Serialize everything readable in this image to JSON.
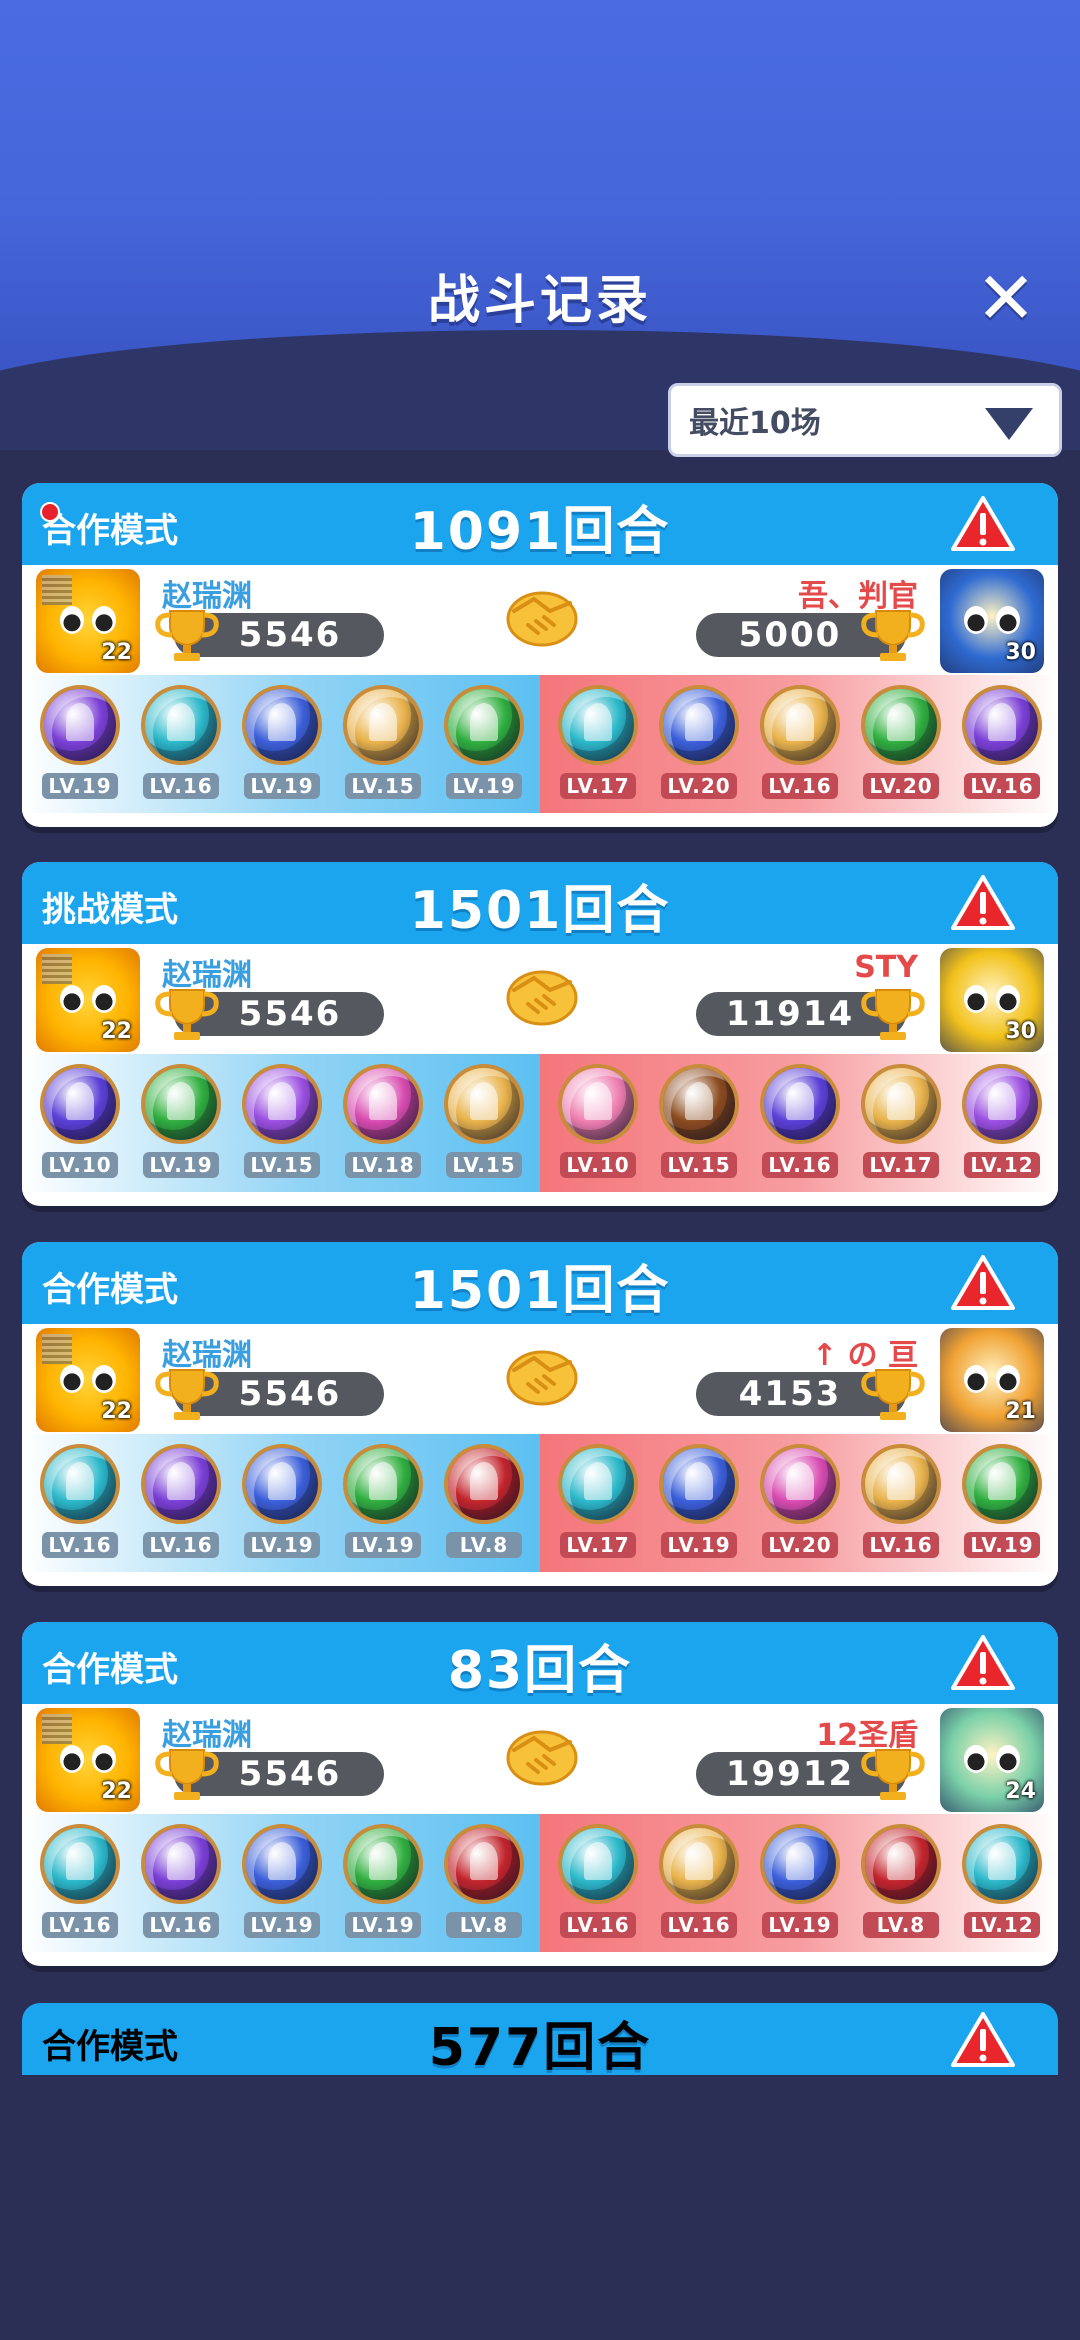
{
  "header": {
    "title": "战斗记录",
    "close_label": "✕"
  },
  "filter": {
    "label": "最近10场"
  },
  "orb_colors": {
    "purple": "#7a3fd6",
    "teal": "#2bb8c9",
    "blue": "#3b5fd9",
    "gold": "#e8b24a",
    "green": "#2fae3e",
    "pink": "#d84bb0",
    "red": "#c2242b",
    "brown": "#8b4a1e",
    "rose": "#ee7fb0"
  },
  "cards": [
    {
      "mode": "合作模式",
      "rounds": "1091回合",
      "left": {
        "name": "赵瑞渊",
        "score": "5546",
        "avatar_level": "22"
      },
      "right": {
        "name": "吾、判官",
        "score": "5000",
        "avatar_level": "30",
        "avatar_color": "#2f6bd1"
      },
      "left_pets": [
        {
          "level": "LV.19",
          "color": "#7a3fd6"
        },
        {
          "level": "LV.16",
          "color": "#2bb8c9"
        },
        {
          "level": "LV.19",
          "color": "#3b5fd9"
        },
        {
          "level": "LV.15",
          "color": "#e8b24a"
        },
        {
          "level": "LV.19",
          "color": "#2fae3e"
        }
      ],
      "right_pets": [
        {
          "level": "LV.17",
          "color": "#2bb8c9"
        },
        {
          "level": "LV.20",
          "color": "#3b5fd9"
        },
        {
          "level": "LV.16",
          "color": "#e8b24a"
        },
        {
          "level": "LV.20",
          "color": "#2fae3e"
        },
        {
          "level": "LV.16",
          "color": "#7a3fd6"
        }
      ]
    },
    {
      "mode": "挑战模式",
      "rounds": "1501回合",
      "left": {
        "name": "赵瑞渊",
        "score": "5546",
        "avatar_level": "22"
      },
      "right": {
        "name": "STY",
        "score": "11914",
        "avatar_level": "30",
        "avatar_color": "#f2c21b"
      },
      "left_pets": [
        {
          "level": "LV.10",
          "color": "#5b3fd6"
        },
        {
          "level": "LV.19",
          "color": "#2fae3e"
        },
        {
          "level": "LV.15",
          "color": "#9a4fe0"
        },
        {
          "level": "LV.18",
          "color": "#d84bb0"
        },
        {
          "level": "LV.15",
          "color": "#e8b24a"
        }
      ],
      "right_pets": [
        {
          "level": "LV.10",
          "color": "#ee7fb0"
        },
        {
          "level": "LV.15",
          "color": "#8b4a1e"
        },
        {
          "level": "LV.16",
          "color": "#5b3fd6"
        },
        {
          "level": "LV.17",
          "color": "#e8b24a"
        },
        {
          "level": "LV.12",
          "color": "#9a4fe0"
        }
      ]
    },
    {
      "mode": "合作模式",
      "rounds": "1501回合",
      "left": {
        "name": "赵瑞渊",
        "score": "5546",
        "avatar_level": "22"
      },
      "right": {
        "name": "↑ の 亘",
        "score": "4153",
        "avatar_level": "21",
        "avatar_color": "#f0a233"
      },
      "left_pets": [
        {
          "level": "LV.16",
          "color": "#2bb8c9"
        },
        {
          "level": "LV.16",
          "color": "#7a3fd6"
        },
        {
          "level": "LV.19",
          "color": "#3b5fd9"
        },
        {
          "level": "LV.19",
          "color": "#2fae3e"
        },
        {
          "level": "LV.8",
          "color": "#c2242b"
        }
      ],
      "right_pets": [
        {
          "level": "LV.17",
          "color": "#2bb8c9"
        },
        {
          "level": "LV.19",
          "color": "#3b5fd9"
        },
        {
          "level": "LV.20",
          "color": "#d84bb0"
        },
        {
          "level": "LV.16",
          "color": "#e8b24a"
        },
        {
          "level": "LV.19",
          "color": "#2fae3e"
        }
      ]
    },
    {
      "mode": "合作模式",
      "rounds": "83回合",
      "left": {
        "name": "赵瑞渊",
        "score": "5546",
        "avatar_level": "22"
      },
      "right": {
        "name": "12圣盾",
        "score": "19912",
        "avatar_level": "24",
        "avatar_color": "#7ad0a8"
      },
      "left_pets": [
        {
          "level": "LV.16",
          "color": "#2bb8c9"
        },
        {
          "level": "LV.16",
          "color": "#7a3fd6"
        },
        {
          "level": "LV.19",
          "color": "#3b5fd9"
        },
        {
          "level": "LV.19",
          "color": "#2fae3e"
        },
        {
          "level": "LV.8",
          "color": "#c2242b"
        }
      ],
      "right_pets": [
        {
          "level": "LV.16",
          "color": "#2bb8c9"
        },
        {
          "level": "LV.16",
          "color": "#e8b24a"
        },
        {
          "level": "LV.19",
          "color": "#3b5fd9"
        },
        {
          "level": "LV.8",
          "color": "#c2242b"
        },
        {
          "level": "LV.12",
          "color": "#2bb8c9"
        }
      ]
    }
  ],
  "partial_card": {
    "mode": "合作模式",
    "rounds": "577回合"
  }
}
